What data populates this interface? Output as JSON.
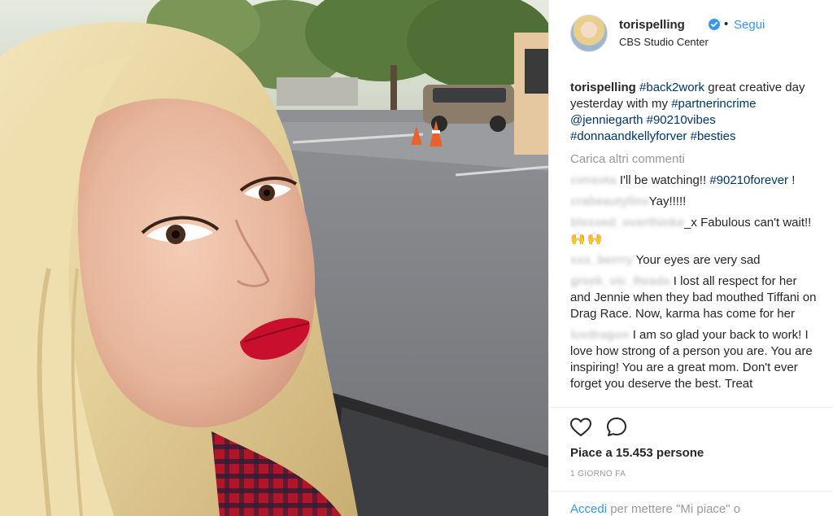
{
  "post": {
    "username": "torispelling",
    "follow_label": "Segui",
    "separator": "•",
    "location": "CBS Studio Center"
  },
  "caption": {
    "username": "torispelling",
    "tag1": "#back2work",
    "text1": "great creative day yesterday with my",
    "tag2": "#partnerincrime",
    "mention": "@jenniegarth",
    "tag3": "#90210vibes",
    "tag4": "#donnaandkellyforver",
    "tag5": "#besties"
  },
  "load_more_label": "Carica altri commenti",
  "comments": [
    {
      "user": "cvnsota",
      "text": "I'll be watching!!",
      "tag": "#90210forever",
      "after": " !"
    },
    {
      "user": "crabeautylinv",
      "text": "Yay!!!!!"
    },
    {
      "user": "blessed_overthinke",
      "text": "_x Fabulous can't wait!!",
      "emoji": "🙌🙌"
    },
    {
      "user": "xxx_berrry",
      "text": "Your eyes are very sad"
    },
    {
      "user": "greek_vic_Reads",
      "text": "I lost all respect for her and Jennie when they bad mouthed Tiffani on Drag Race. Now, karma has come for her"
    },
    {
      "user": "luvdragon",
      "text": "I am so glad your back to work! I love how strong of a person you are. You are inspiring! You are a great mom. Don't ever forget you deserve the best. Treat"
    }
  ],
  "icons": {
    "like": "heart-icon",
    "comment": "comment-icon",
    "verified": "verified-badge-icon"
  },
  "likes_text": "Piace a 15.453 persone",
  "time_ago": "1 GIORNO FA",
  "login": {
    "link": "Accedi",
    "rest": "per mettere \"Mi piace\" o"
  },
  "colors": {
    "link": "#3897f0",
    "hashtag": "#003569",
    "muted": "#999999",
    "lipstick": "#c8102e"
  }
}
